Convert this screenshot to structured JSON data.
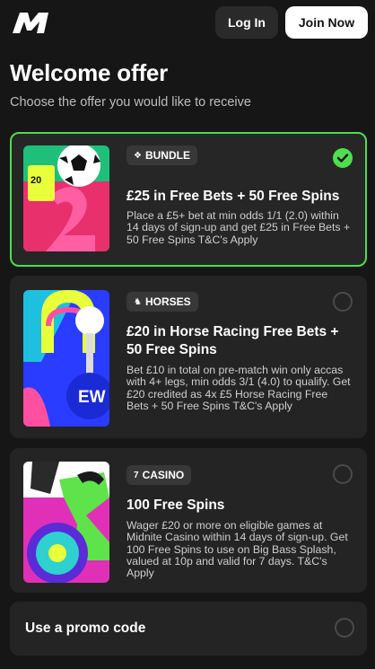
{
  "header": {
    "logo_icon": "midnite-logo-icon",
    "login_label": "Log In",
    "join_label": "Join Now"
  },
  "page": {
    "title": "Welcome offer",
    "subtitle": "Choose the offer you would like to receive"
  },
  "offers": [
    {
      "badge": "BUNDLE",
      "badge_icon": "stack-icon",
      "title": "£25 in Free Bets + 50 Free Spins",
      "description": "Place a £5+ bet at min odds 1/1 (2.0) within 14 days of sign-up and get £25 in Free Bets + 50 Free Spins T&C's Apply",
      "selected": true
    },
    {
      "badge": "HORSES",
      "badge_icon": "horse-icon",
      "title": "£20 in Horse Racing Free Bets + 50 Free Spins",
      "description": "Bet £10 in total on pre-match win only accas with 4+ legs, min odds 3/1 (4.0) to qualify. Get £20 credited as 4x £5 Horse Racing Free Bets + 50 Free Spins T&C's Apply",
      "selected": false,
      "image_text": "EW"
    },
    {
      "badge": "CASINO",
      "badge_icon": "slot-seven-icon",
      "title": "100 Free Spins",
      "description": "Wager £20 or more on eligible games at Midnite Casino within 14 days of sign-up. Get 100 Free Spins to use on Big Bass Splash, valued at 10p and valid for 7 days. T&C's Apply",
      "selected": false
    }
  ],
  "promo": {
    "label": "Use a promo code"
  },
  "colors": {
    "background": "#161616",
    "card": "#242424",
    "accent_green": "#4ede4e"
  }
}
